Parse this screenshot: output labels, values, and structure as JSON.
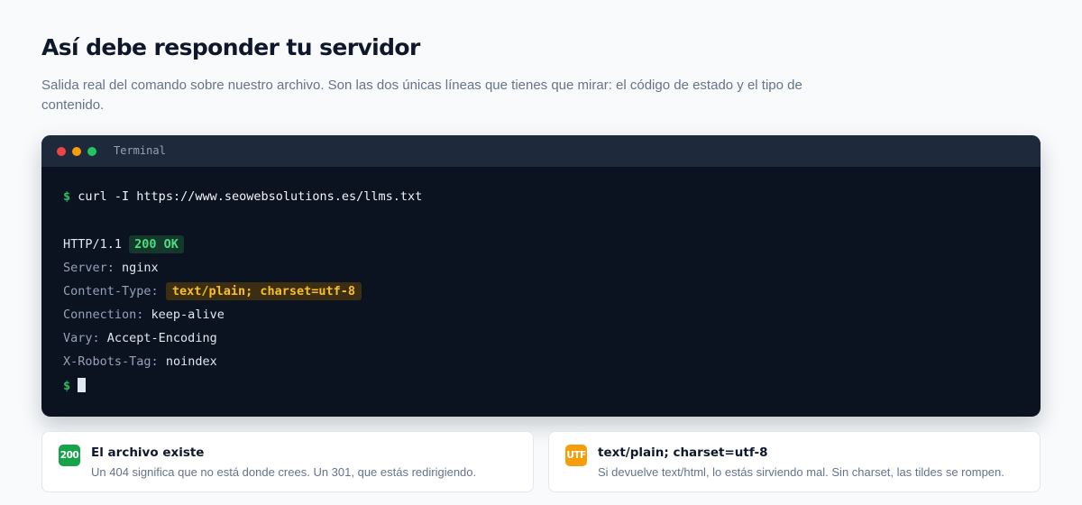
{
  "header": {
    "title": "Así debe responder tu servidor",
    "subtitle": "Salida real del comando sobre nuestro archivo. Son las dos únicas líneas que tienes que mirar: el código de estado y el tipo de contenido."
  },
  "terminal": {
    "title": "Terminal",
    "prompt": "$",
    "command": "curl -I https://www.seowebsolutions.es/llms.txt",
    "status": {
      "protocol": "HTTP/1.1",
      "code": "200 OK"
    },
    "headers": [
      {
        "key": "Server:",
        "value": "nginx"
      },
      {
        "key": "Content-Type:",
        "value": "text/plain; charset=utf-8"
      },
      {
        "key": "Connection:",
        "value": "keep-alive"
      },
      {
        "key": "Vary:",
        "value": "Accept-Encoding"
      },
      {
        "key": "X-Robots-Tag:",
        "value": "noindex"
      }
    ],
    "end_prompt": "$"
  },
  "cards": [
    {
      "icon_name": "status-200-icon",
      "icon_text": "200",
      "icon_color": "#16a34a",
      "title": "El archivo existe",
      "description": "Un 404 significa que no está donde crees. Un 301, que estás redirigiendo."
    },
    {
      "icon_name": "utf-encoding-icon",
      "icon_text": "UTF",
      "icon_color": "#f59e0b",
      "title": "text/plain; charset=utf-8",
      "description": "Si devuelve text/html, lo estás sirviendo mal. Sin charset, las tildes se rompen."
    }
  ],
  "colors": {
    "page_background": "#f8fafc",
    "terminal_background": "#0b1220",
    "terminal_bar": "#1e293b",
    "prompt_green": "#22c55e",
    "status_ok": "#4ade80",
    "content_type_highlight": "#fbbf24"
  }
}
